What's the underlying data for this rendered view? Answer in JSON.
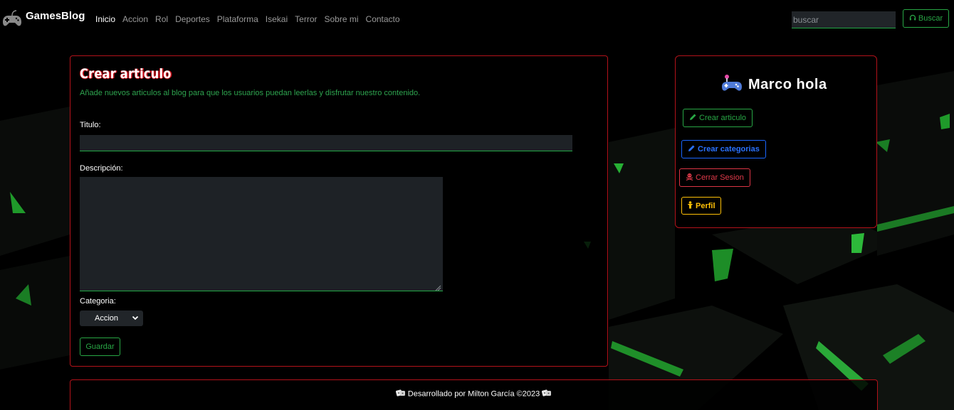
{
  "brand": {
    "name": "GamesBlog",
    "icon": "gamepad-icon"
  },
  "nav": {
    "items": [
      {
        "label": "Inicio",
        "active": true
      },
      {
        "label": "Accion",
        "active": false
      },
      {
        "label": "Rol",
        "active": false
      },
      {
        "label": "Deportes",
        "active": false
      },
      {
        "label": "Plataforma",
        "active": false
      },
      {
        "label": "Isekai",
        "active": false
      },
      {
        "label": "Terror",
        "active": false
      },
      {
        "label": "Sobre mi",
        "active": false
      },
      {
        "label": "Contacto",
        "active": false
      }
    ]
  },
  "search": {
    "placeholder": "buscar",
    "button_label": "Buscar",
    "button_icon": "headset-icon"
  },
  "form": {
    "title": "Crear articulo",
    "subtitle": "Añade nuevos articulos al blog para que los usuarios puedan leerlas y disfrutar nuestro contenido.",
    "title_label": "Titulo:",
    "title_value": "",
    "description_label": "Descripción:",
    "description_value": "",
    "category_label": "Categoria:",
    "category_selected": "Accion",
    "save_label": "Guardar"
  },
  "sidebar": {
    "user_name": "Marco hola",
    "user_icon": "gamepad-icon",
    "buttons": {
      "create_article": "Crear articulo",
      "create_category": "Crear categorias",
      "logout": "Cerrar Sesion",
      "profile": "Perfil"
    }
  },
  "footer": {
    "text": "Desarrollado por Milton García ©2023"
  },
  "colors": {
    "accent_green": "#28a745",
    "border_red": "#b3121a",
    "blue": "#1a66ff",
    "danger": "#dc3545",
    "warning": "#ffc107"
  }
}
